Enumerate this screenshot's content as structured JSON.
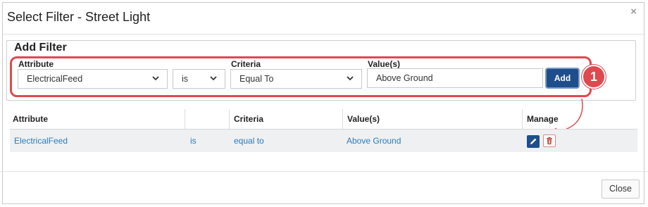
{
  "dialog": {
    "title": "Select Filter - Street Light",
    "close_icon": "×"
  },
  "add_filter": {
    "legend": "Add Filter",
    "attribute_label": "Attribute",
    "attribute_value": "ElectricalFeed",
    "operator_value": "is",
    "criteria_label": "Criteria",
    "criteria_value": "Equal To",
    "values_label": "Value(s)",
    "values_value": "Above Ground",
    "add_button": "Add",
    "callout_number": "1"
  },
  "table": {
    "headers": [
      "Attribute",
      "",
      "Criteria",
      "Value(s)",
      "Manage"
    ],
    "rows": [
      {
        "attribute": "ElectricalFeed",
        "operator": "is",
        "criteria": "equal to",
        "value": "Above Ground"
      }
    ]
  },
  "footer": {
    "close_button": "Close"
  },
  "colors": {
    "accent": "#1f4e8c",
    "highlight": "#e0484f",
    "link": "#2c7bb6"
  },
  "icons": {
    "edit": "pencil-icon",
    "delete": "trash-icon",
    "dropdown": "chevron-down-icon"
  }
}
